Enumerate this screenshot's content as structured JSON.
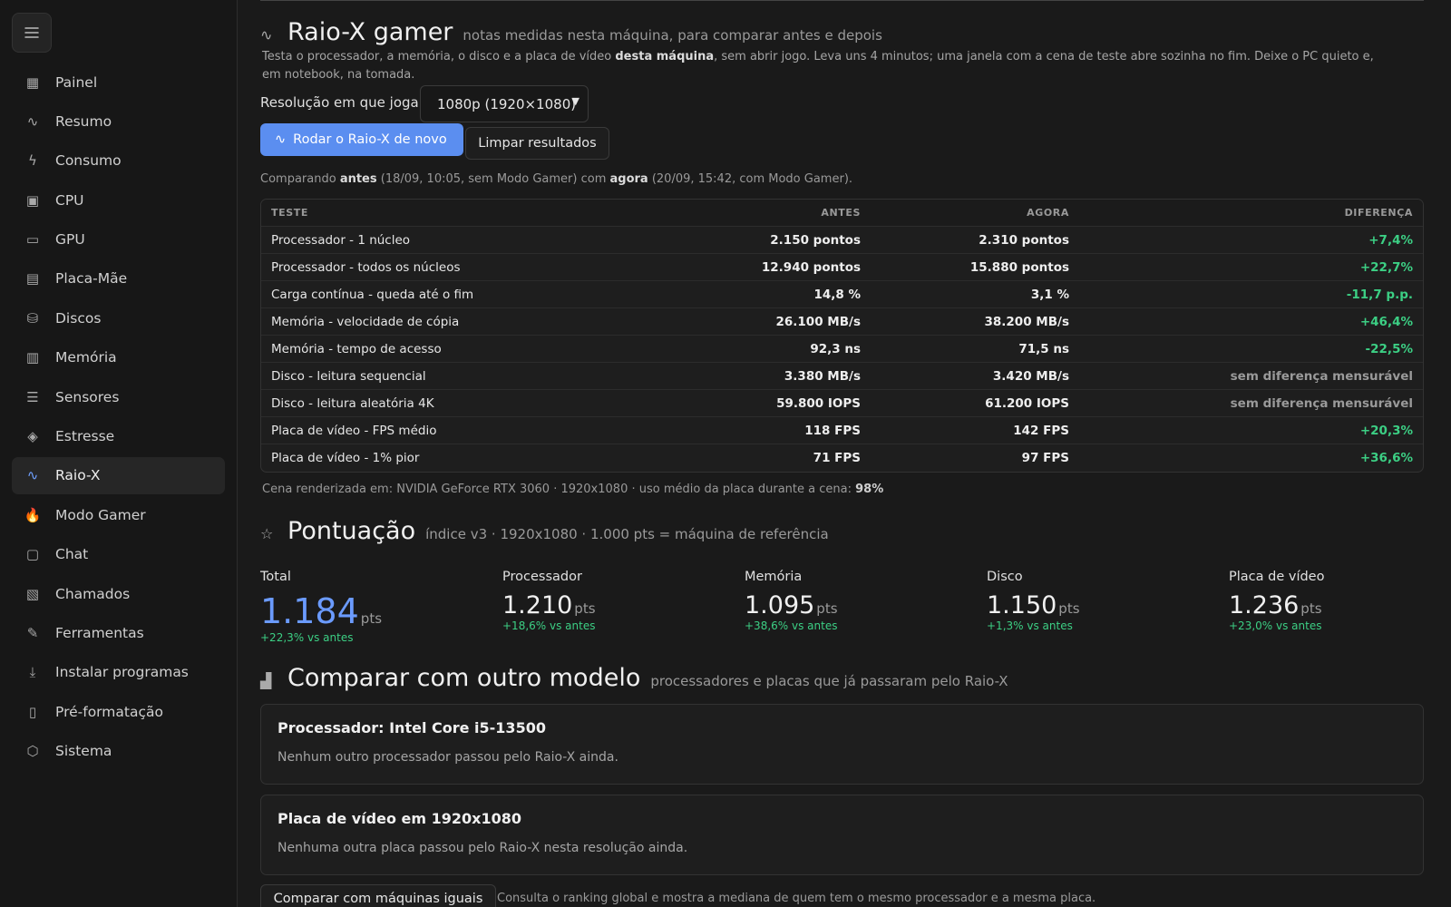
{
  "sidebar": {
    "items": [
      {
        "label": "Painel",
        "icon": "dashboard-icon",
        "glyph": "▦"
      },
      {
        "label": "Resumo",
        "icon": "pulse-icon",
        "glyph": "∿"
      },
      {
        "label": "Consumo",
        "icon": "bolt-icon",
        "glyph": "ϟ"
      },
      {
        "label": "CPU",
        "icon": "cpu-icon",
        "glyph": "▣"
      },
      {
        "label": "GPU",
        "icon": "gpu-icon",
        "glyph": "▭"
      },
      {
        "label": "Placa-Mãe",
        "icon": "motherboard-icon",
        "glyph": "▤"
      },
      {
        "label": "Discos",
        "icon": "database-icon",
        "glyph": "⛁"
      },
      {
        "label": "Memória",
        "icon": "memory-icon",
        "glyph": "▥"
      },
      {
        "label": "Sensores",
        "icon": "sliders-icon",
        "glyph": "☰"
      },
      {
        "label": "Estresse",
        "icon": "flame-icon",
        "glyph": "◈"
      },
      {
        "label": "Raio-X",
        "icon": "pulse-icon",
        "glyph": "∿"
      },
      {
        "label": "Modo Gamer",
        "icon": "fire-emoji-icon",
        "glyph": "🔥"
      },
      {
        "label": "Chat",
        "icon": "chat-icon",
        "glyph": "▢"
      },
      {
        "label": "Chamados",
        "icon": "ticket-icon",
        "glyph": "▧"
      },
      {
        "label": "Ferramentas",
        "icon": "wrench-icon",
        "glyph": "✎"
      },
      {
        "label": "Instalar programas",
        "icon": "download-icon",
        "glyph": "⤓"
      },
      {
        "label": "Pré-formatação",
        "icon": "document-icon",
        "glyph": "▯"
      },
      {
        "label": "Sistema",
        "icon": "cube-icon",
        "glyph": "⬡"
      }
    ],
    "active_index": 10
  },
  "raiox": {
    "title": "Raio-X gamer",
    "subtitle": "notas medidas nesta máquina, para comparar antes e depois",
    "desc_pre": "Testa o processador, a memória, o disco e a placa de vídeo ",
    "desc_bold": "desta máquina",
    "desc_post": ", sem abrir jogo. Leva uns 4 minutos; uma janela com a cena de teste abre sozinha no fim. Deixe o PC quieto e, em notebook, na tomada.",
    "resolution_label": "Resolução em que joga",
    "resolution_value": "1080p (1920×1080)",
    "run_button": "Rodar o Raio-X de novo",
    "clear_button": "Limpar resultados",
    "compare_pre": "Comparando ",
    "compare_before": "antes",
    "compare_mid": " (18/09, 10:05, sem Modo Gamer) com ",
    "compare_now": "agora",
    "compare_post": " (20/09, 15:42, com Modo Gamer)."
  },
  "table": {
    "headers": [
      "TESTE",
      "ANTES",
      "AGORA",
      "DIFERENÇA"
    ],
    "rows": [
      {
        "test": "Processador - 1 núcleo",
        "before": "2.150 pontos",
        "now": "2.310 pontos",
        "diff": "+7,4%",
        "diff_kind": "pos"
      },
      {
        "test": "Processador - todos os núcleos",
        "before": "12.940 pontos",
        "now": "15.880 pontos",
        "diff": "+22,7%",
        "diff_kind": "pos"
      },
      {
        "test": "Carga contínua - queda até o fim",
        "before": "14,8 %",
        "now": "3,1 %",
        "diff": "-11,7 p.p.",
        "diff_kind": "pos"
      },
      {
        "test": "Memória - velocidade de cópia",
        "before": "26.100 MB/s",
        "now": "38.200 MB/s",
        "diff": "+46,4%",
        "diff_kind": "pos"
      },
      {
        "test": "Memória - tempo de acesso",
        "before": "92,3 ns",
        "now": "71,5 ns",
        "diff": "-22,5%",
        "diff_kind": "pos"
      },
      {
        "test": "Disco - leitura sequencial",
        "before": "3.380 MB/s",
        "now": "3.420 MB/s",
        "diff": "sem diferença mensurável",
        "diff_kind": "neu"
      },
      {
        "test": "Disco - leitura aleatória 4K",
        "before": "59.800 IOPS",
        "now": "61.200 IOPS",
        "diff": "sem diferença mensurável",
        "diff_kind": "neu"
      },
      {
        "test": "Placa de vídeo - FPS médio",
        "before": "118 FPS",
        "now": "142 FPS",
        "diff": "+20,3%",
        "diff_kind": "pos"
      },
      {
        "test": "Placa de vídeo - 1% pior",
        "before": "71 FPS",
        "now": "97 FPS",
        "diff": "+36,6%",
        "diff_kind": "pos"
      }
    ]
  },
  "scene": {
    "text": "Cena renderizada em: NVIDIA GeForce RTX 3060 · 1920x1080 · uso médio da placa durante a cena: ",
    "usage": "98%"
  },
  "pontuacao": {
    "title": "Pontuação",
    "subtitle": "índice v3 · 1920x1080 · 1.000 pts = máquina de referência",
    "scores": [
      {
        "label": "Total",
        "value": "1.184",
        "unit": "pts",
        "delta": "+22,3% vs antes"
      },
      {
        "label": "Processador",
        "value": "1.210",
        "unit": "pts",
        "delta": "+18,6% vs antes"
      },
      {
        "label": "Memória",
        "value": "1.095",
        "unit": "pts",
        "delta": "+38,6% vs antes"
      },
      {
        "label": "Disco",
        "value": "1.150",
        "unit": "pts",
        "delta": "+1,3% vs antes"
      },
      {
        "label": "Placa de vídeo",
        "value": "1.236",
        "unit": "pts",
        "delta": "+23,0% vs antes"
      }
    ]
  },
  "comparar": {
    "title": "Comparar com outro modelo",
    "subtitle": "processadores e placas que já passaram pelo Raio-X",
    "cpu_card_title": "Processador: Intel Core i5-13500",
    "cpu_card_body": "Nenhum outro processador passou pelo Raio-X ainda.",
    "gpu_card_title": "Placa de vídeo em 1920x1080",
    "gpu_card_body": "Nenhuma outra placa passou pelo Raio-X nesta resolução ainda.",
    "compare_button": "Comparar com máquinas iguais",
    "compare_hint": "Consulta o ranking global e mostra a mediana de quem tem o mesmo processador e a mesma placa."
  },
  "colors": {
    "accent": "#5b8ef0",
    "positive": "#3ccf84",
    "background": "#1a1a1a",
    "sidebar": "#171717"
  }
}
